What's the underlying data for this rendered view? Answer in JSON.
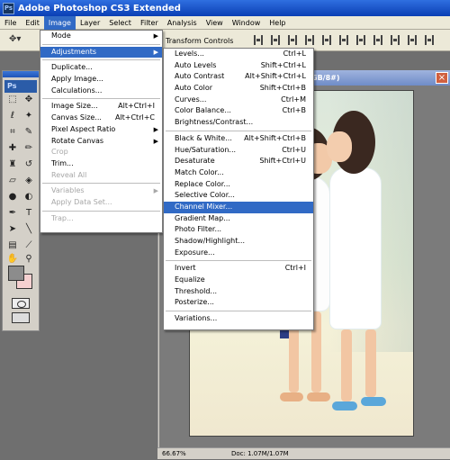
{
  "app": {
    "title": "Adobe Photoshop CS3 Extended",
    "logo": "Ps"
  },
  "menubar": [
    "File",
    "Edit",
    "Image",
    "Layer",
    "Select",
    "Filter",
    "Analysis",
    "View",
    "Window",
    "Help"
  ],
  "optionsbar": {
    "transform_label": "ow Transform Controls"
  },
  "document": {
    "title_fragment": "GB/8#)",
    "zoom": "66.67%",
    "doc_info": "Doc: 1.07M/1.07M"
  },
  "image_menu": [
    {
      "label": "Mode",
      "submenu": true
    },
    {
      "sep": true
    },
    {
      "label": "Adjustments",
      "submenu": true,
      "highlighted": true
    },
    {
      "sep": true
    },
    {
      "label": "Duplicate..."
    },
    {
      "label": "Apply Image..."
    },
    {
      "label": "Calculations..."
    },
    {
      "sep": true
    },
    {
      "label": "Image Size...",
      "shortcut": "Alt+Ctrl+I"
    },
    {
      "label": "Canvas Size...",
      "shortcut": "Alt+Ctrl+C"
    },
    {
      "label": "Pixel Aspect Ratio",
      "submenu": true
    },
    {
      "label": "Rotate Canvas",
      "submenu": true
    },
    {
      "label": "Crop",
      "disabled": true
    },
    {
      "label": "Trim..."
    },
    {
      "label": "Reveal All",
      "disabled": true
    },
    {
      "sep": true
    },
    {
      "label": "Variables",
      "submenu": true,
      "disabled": true
    },
    {
      "label": "Apply Data Set...",
      "disabled": true
    },
    {
      "sep": true
    },
    {
      "label": "Trap...",
      "disabled": true
    }
  ],
  "adjustments_menu": [
    {
      "label": "Levels...",
      "shortcut": "Ctrl+L"
    },
    {
      "label": "Auto Levels",
      "shortcut": "Shift+Ctrl+L"
    },
    {
      "label": "Auto Contrast",
      "shortcut": "Alt+Shift+Ctrl+L"
    },
    {
      "label": "Auto Color",
      "shortcut": "Shift+Ctrl+B"
    },
    {
      "label": "Curves...",
      "shortcut": "Ctrl+M"
    },
    {
      "label": "Color Balance...",
      "shortcut": "Ctrl+B"
    },
    {
      "label": "Brightness/Contrast..."
    },
    {
      "sep": true
    },
    {
      "label": "Black & White...",
      "shortcut": "Alt+Shift+Ctrl+B"
    },
    {
      "label": "Hue/Saturation...",
      "shortcut": "Ctrl+U"
    },
    {
      "label": "Desaturate",
      "shortcut": "Shift+Ctrl+U"
    },
    {
      "label": "Match Color..."
    },
    {
      "label": "Replace Color..."
    },
    {
      "label": "Selective Color..."
    },
    {
      "label": "Channel Mixer...",
      "highlighted": true
    },
    {
      "label": "Gradient Map..."
    },
    {
      "label": "Photo Filter..."
    },
    {
      "label": "Shadow/Highlight..."
    },
    {
      "label": "Exposure..."
    },
    {
      "sep": true
    },
    {
      "label": "Invert",
      "shortcut": "Ctrl+I"
    },
    {
      "label": "Equalize"
    },
    {
      "label": "Threshold..."
    },
    {
      "label": "Posterize..."
    },
    {
      "sep": true
    },
    {
      "label": "Variations..."
    }
  ],
  "colors": {
    "titlebar": "#0a3fb4",
    "highlight": "#316ac5",
    "menubar_bg": "#ece9d8",
    "foreground_swatch": "#8c8c8c",
    "background_swatch": "#f5d0d0"
  }
}
